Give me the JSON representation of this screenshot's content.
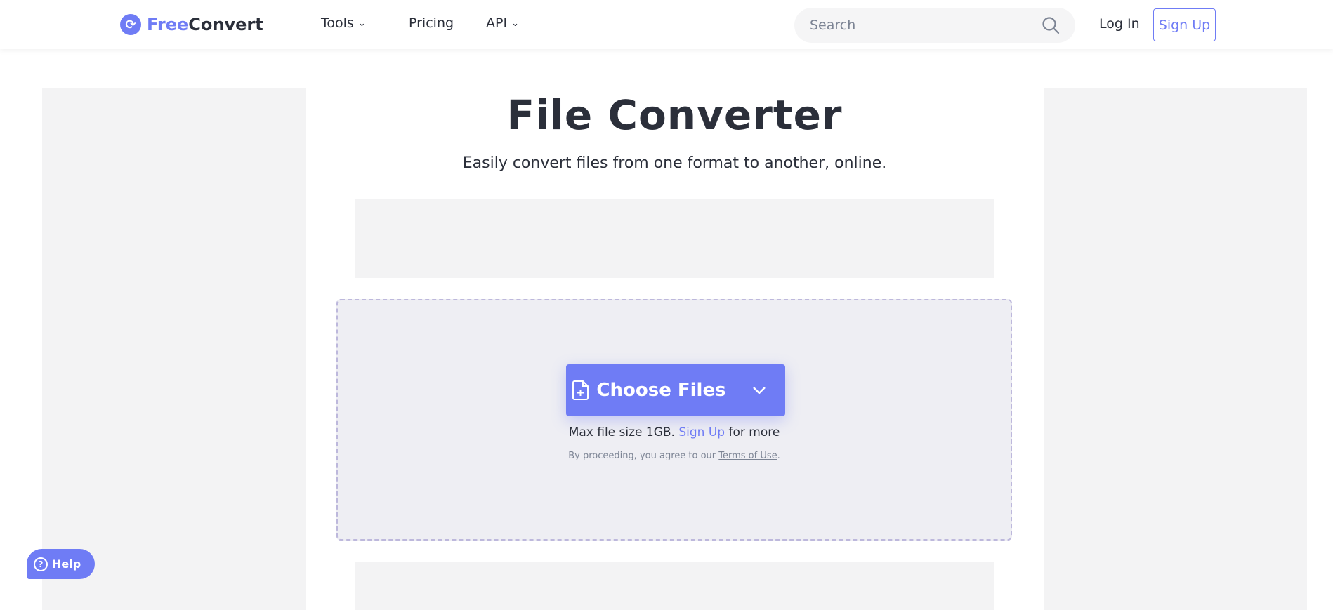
{
  "header": {
    "logo_free": "Free",
    "logo_convert": "Convert",
    "nav": {
      "tools": "Tools",
      "pricing": "Pricing",
      "api": "API"
    },
    "search_placeholder": "Search",
    "login": "Log In",
    "signup": "Sign Up"
  },
  "main": {
    "title": "File Converter",
    "subtitle": "Easily convert files from one format to another, online.",
    "choose_files": "Choose Files",
    "max_size_prefix": "Max file size 1GB.",
    "max_size_link": "Sign Up",
    "max_size_suffix": "for more",
    "terms_prefix": "By proceeding, you agree to our",
    "terms_link": "Terms of Use",
    "terms_suffix": "."
  },
  "help": {
    "label": "Help"
  },
  "colors": {
    "accent": "#6f7cf5",
    "text": "#2b2f3a"
  }
}
